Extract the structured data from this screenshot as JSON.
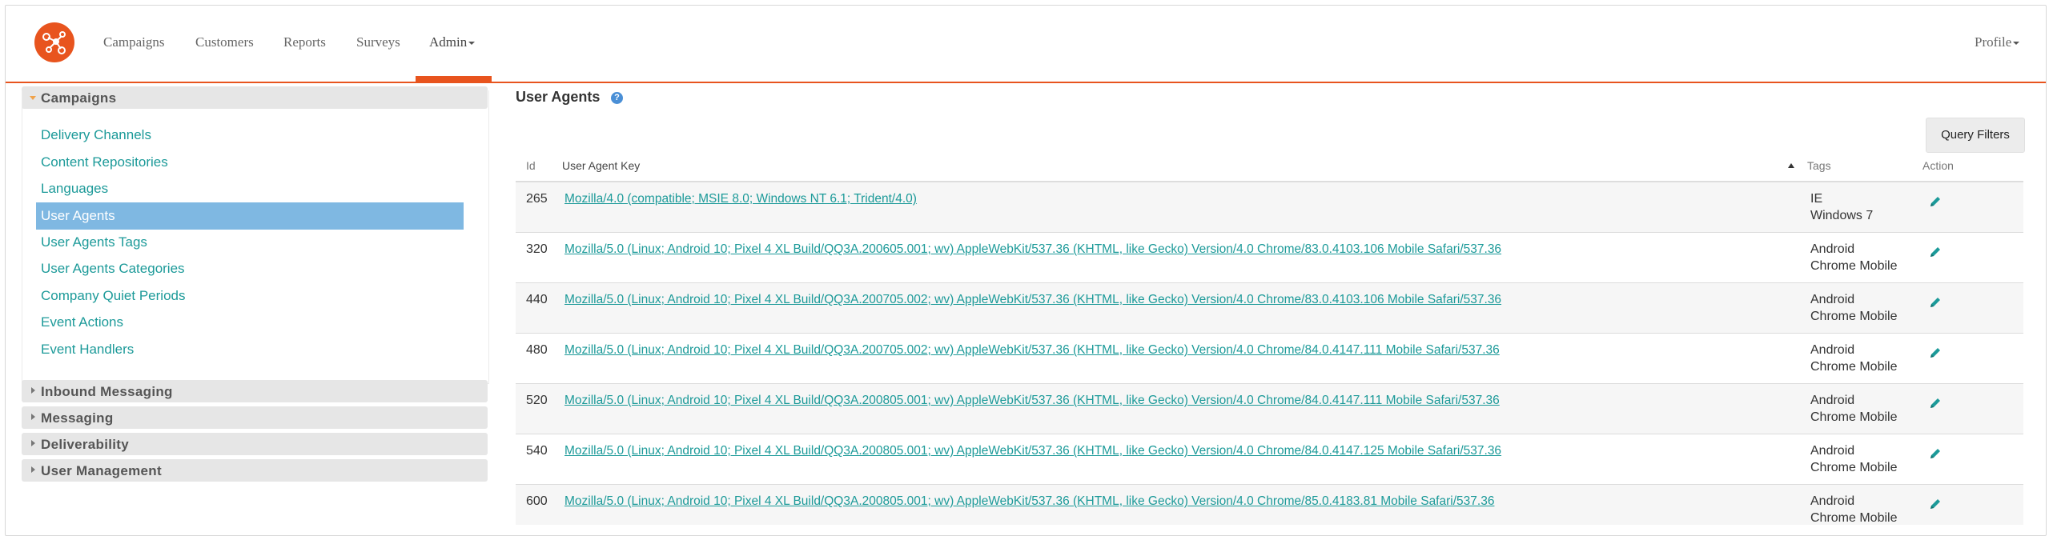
{
  "nav": {
    "items": [
      "Campaigns",
      "Customers",
      "Reports",
      "Surveys"
    ],
    "admin_label": "Admin",
    "profile_label": "Profile"
  },
  "sidebar": {
    "campaigns_header": "Campaigns",
    "links": [
      "Delivery Channels",
      "Content Repositories",
      "Languages",
      "User Agents",
      "User Agents Tags",
      "User Agents Categories",
      "Company Quiet Periods",
      "Event Actions",
      "Event Handlers"
    ],
    "selected": "User Agents",
    "sections": [
      "Inbound Messaging",
      "Messaging",
      "Deliverability",
      "User Management"
    ]
  },
  "main": {
    "title": "User Agents",
    "query_filters_label": "Query Filters",
    "columns": {
      "id": "Id",
      "key": "User Agent Key",
      "tags": "Tags",
      "action": "Action"
    },
    "rows": [
      {
        "id": "265",
        "key": "Mozilla/4.0 (compatible; MSIE 8.0; Windows NT 6.1; Trident/4.0)",
        "tags": [
          "IE",
          "Windows 7"
        ]
      },
      {
        "id": "320",
        "key": "Mozilla/5.0 (Linux; Android 10; Pixel 4 XL Build/QQ3A.200605.001; wv) AppleWebKit/537.36 (KHTML, like Gecko) Version/4.0 Chrome/83.0.4103.106 Mobile Safari/537.36",
        "tags": [
          "Android",
          "Chrome Mobile"
        ]
      },
      {
        "id": "440",
        "key": "Mozilla/5.0 (Linux; Android 10; Pixel 4 XL Build/QQ3A.200705.002; wv) AppleWebKit/537.36 (KHTML, like Gecko) Version/4.0 Chrome/83.0.4103.106 Mobile Safari/537.36",
        "tags": [
          "Android",
          "Chrome Mobile"
        ]
      },
      {
        "id": "480",
        "key": "Mozilla/5.0 (Linux; Android 10; Pixel 4 XL Build/QQ3A.200705.002; wv) AppleWebKit/537.36 (KHTML, like Gecko) Version/4.0 Chrome/84.0.4147.111 Mobile Safari/537.36",
        "tags": [
          "Android",
          "Chrome Mobile"
        ]
      },
      {
        "id": "520",
        "key": "Mozilla/5.0 (Linux; Android 10; Pixel 4 XL Build/QQ3A.200805.001; wv) AppleWebKit/537.36 (KHTML, like Gecko) Version/4.0 Chrome/84.0.4147.111 Mobile Safari/537.36",
        "tags": [
          "Android",
          "Chrome Mobile"
        ]
      },
      {
        "id": "540",
        "key": "Mozilla/5.0 (Linux; Android 10; Pixel 4 XL Build/QQ3A.200805.001; wv) AppleWebKit/537.36 (KHTML, like Gecko) Version/4.0 Chrome/84.0.4147.125 Mobile Safari/537.36",
        "tags": [
          "Android",
          "Chrome Mobile"
        ]
      },
      {
        "id": "600",
        "key": "Mozilla/5.0 (Linux; Android 10; Pixel 4 XL Build/QQ3A.200805.001; wv) AppleWebKit/537.36 (KHTML, like Gecko) Version/4.0 Chrome/85.0.4183.81 Mobile Safari/537.36",
        "tags": [
          "Android",
          "Chrome Mobile"
        ]
      }
    ]
  },
  "icons": {
    "logo": "connected-nodes-logo",
    "help": "help-icon",
    "edit": "pencil-icon"
  },
  "colors": {
    "accent": "#e8541e",
    "link": "#1c9a99",
    "selected": "#7fb8e2"
  }
}
